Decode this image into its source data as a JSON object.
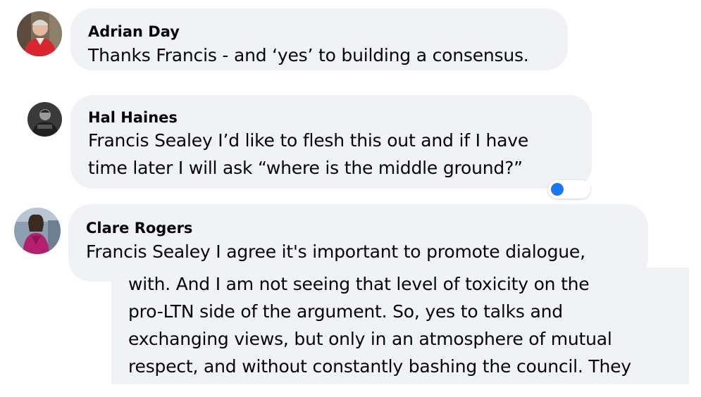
{
  "comments": [
    {
      "author": "Adrian Day",
      "avatar_icon": "profile-photo-red-jacket",
      "lines": [
        "Thanks Francis - and ‘yes’ to building a consensus."
      ]
    },
    {
      "author": "Hal Haines",
      "avatar_icon": "profile-photo-dark-jacket",
      "lines": [
        "Francis Sealey I’d like to flesh this out and if I have",
        "time later I will ask “where is the middle ground?”"
      ]
    },
    {
      "author": "Clare Rogers",
      "avatar_icon": "profile-photo-magenta-dress",
      "lines": [
        "Francis Sealey I agree it's important to promote dialogue,"
      ]
    }
  ],
  "overlay_excerpt": {
    "lines": [
      "with. And I am not seeing that level of toxicity on the",
      "pro-LTN side of the argument. So, yes to talks and",
      "exchanging views, but only in an atmosphere of mutual",
      "respect, and without constantly bashing the council. They"
    ]
  },
  "colors": {
    "bubble_bg": "#f0f2f5",
    "text": "#050505",
    "reaction_blue": "#1877f2"
  }
}
